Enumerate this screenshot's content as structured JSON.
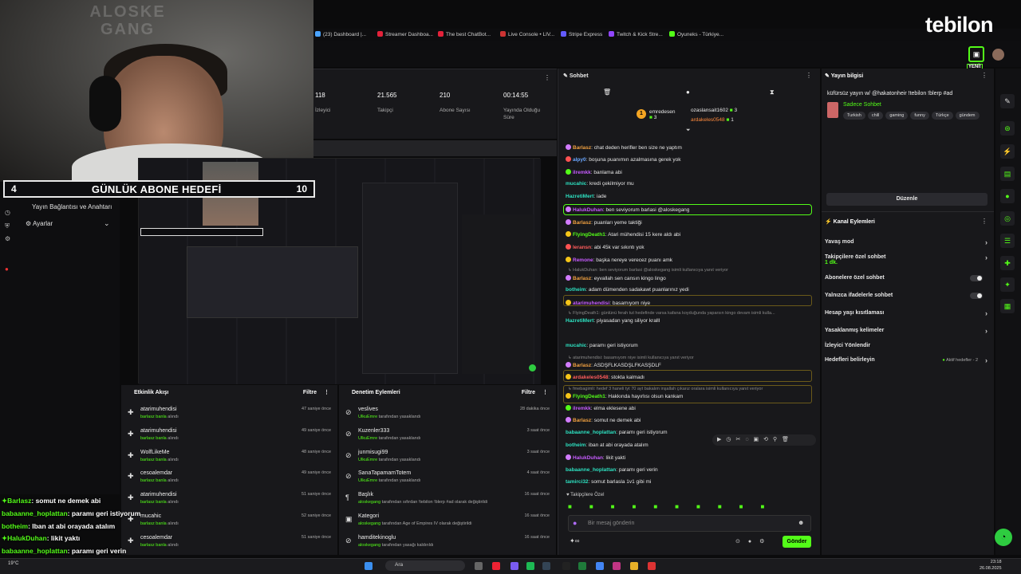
{
  "webcam": {
    "watermark": "ALOSKE GANG"
  },
  "brand": {
    "name": "tebilon"
  },
  "browser_tabs": [
    {
      "label": "(23) Dashboard |...",
      "color": "#4aa3ff"
    },
    {
      "label": "Streamer Dashboa...",
      "color": "#e3223a"
    },
    {
      "label": "The best ChatBot...",
      "color": "#e3223a"
    },
    {
      "label": "Live Console • LIV...",
      "color": "#cc3333"
    },
    {
      "label": "Stripe Express",
      "color": "#635bff"
    },
    {
      "label": "Twitch & Kick Stre...",
      "color": "#9146ff"
    },
    {
      "label": "Oyuneks - Türkiye...",
      "color": "#53fc18"
    }
  ],
  "new_badge": "YENİ!",
  "stats": [
    {
      "value": "118",
      "label": "İzleyici"
    },
    {
      "value": "21.565",
      "label": "Takipçi"
    },
    {
      "value": "210",
      "label": "Abone Sayısı"
    },
    {
      "value": "00:14:55",
      "label": "Yayında Olduğu Süre"
    }
  ],
  "abone_hedefi": {
    "current": "4",
    "title": "GÜNLÜK ABONE HEDEFİ",
    "target": "10"
  },
  "left_menu": {
    "connection": "Yayın Bağlantısı ve Anahtarı",
    "settings": "Ayarlar"
  },
  "activity": {
    "title": "Etkinlik Akışı",
    "filter": "Filtre",
    "items": [
      {
        "name": "atarimuhendisi",
        "sub_user": "barlasz",
        "sub_text": "banla",
        "sub_tail": "alındı",
        "time": "47 saniye önce"
      },
      {
        "name": "atarimuhendisi",
        "sub_user": "barlasz",
        "sub_text": "banla",
        "sub_tail": "alındı",
        "time": "49 saniye önce"
      },
      {
        "name": "WolfLikeMe",
        "sub_user": "barlasz",
        "sub_text": "banla",
        "sub_tail": "alındı",
        "time": "48 saniye önce"
      },
      {
        "name": "cesoalemdar",
        "sub_user": "barlasz",
        "sub_text": "banla",
        "sub_tail": "alındı",
        "time": "49 saniye önce"
      },
      {
        "name": "atarimuhendisi",
        "sub_user": "barlasz",
        "sub_text": "banla",
        "sub_tail": "alındı",
        "time": "51 saniye önce"
      },
      {
        "name": "mucahic",
        "sub_user": "barlasz",
        "sub_text": "banla",
        "sub_tail": "alındı",
        "time": "52 saniye önce"
      },
      {
        "name": "cesoalemdar",
        "sub_user": "barlasz",
        "sub_text": "banla",
        "sub_tail": "alındı",
        "time": "51 saniye önce"
      }
    ]
  },
  "moderation": {
    "title": "Denetim Eylemleri",
    "filter": "Filtre",
    "items": [
      {
        "icon": "⊘",
        "name": "veslives",
        "sub_user": "UlkuEmre",
        "sub_text": "tarafından yasaklandı",
        "time": "28 dakika önce"
      },
      {
        "icon": "⊘",
        "name": "Kuzenler333",
        "sub_user": "UlkuEmre",
        "sub_text": "tarafından yasaklandı",
        "time": "3 saat önce"
      },
      {
        "icon": "⊘",
        "name": "junmisugi99",
        "sub_user": "UlkuEmre",
        "sub_text": "tarafından yasaklandı",
        "time": "3 saat önce"
      },
      {
        "icon": "⊘",
        "name": "SanaTapamamTotem",
        "sub_user": "UlkuEmre",
        "sub_text": "tarafından yasaklandı",
        "time": "4 saat önce"
      },
      {
        "icon": "¶",
        "name": "Başlık",
        "sub_user": "aloskegang",
        "sub_text": "tarafından sıfırdan !tebilon !blerp #ad olarak değiştirildi",
        "time": "16 saat önce"
      },
      {
        "icon": "▣",
        "name": "Kategori",
        "sub_user": "aloskegang",
        "sub_text": "tarafından Age of Empires IV olarak değiştirildi",
        "time": "16 saat önce"
      },
      {
        "icon": "⊘",
        "name": "hamditekinoglu",
        "sub_user": "aloskegang",
        "sub_text": "tarafından yasağı kaldırıldı",
        "time": "16 saat önce"
      }
    ]
  },
  "overlay_chat": [
    {
      "user": "Barlasz",
      "text": ": somut ne demek abi",
      "icon": "✦"
    },
    {
      "user": "babaanne_hoplattan",
      "text": ": paramı geri istiyorum",
      "icon": ""
    },
    {
      "user": "botheim",
      "text": ": Iban at abi orayada atalım",
      "icon": ""
    },
    {
      "user": "HalukDuhan",
      "text": ": likit yaktı",
      "icon": "✦"
    },
    {
      "user": "babaanne_hoplattan",
      "text": ": paramı geri verin",
      "icon": ""
    },
    {
      "user": "tamirci32",
      "text": ": somut barlasla 1v1 gibi mi",
      "icon": ""
    }
  ],
  "chat": {
    "title": "Sohbet",
    "top_gifters": {
      "first": "emredesen",
      "first_count": "3",
      "second": "ozaslansait1602",
      "second_count": "3",
      "third": "ardakeles0548",
      "third_count": "1"
    },
    "messages": [
      {
        "user": "Barlasz",
        "color": "#f0a040",
        "text": ": chat deden herifler ben size ne yaptım",
        "badge": "#d27cff"
      },
      {
        "user": "alpy0",
        "color": "#6aa7ff",
        "text": ": boşuna puanımın azalmasına gerek yok",
        "badge": "#ff5252"
      },
      {
        "user": "ilremkk",
        "color": "#c75cff",
        "text": ": banlama abi",
        "badge": "#53fc18"
      },
      {
        "user": "mucahic",
        "color": "#2de0c0",
        "text": ": kredi çekilmiyor mu",
        "badge": ""
      },
      {
        "user": "HazretiMert",
        "color": "#2de0c0",
        "text": ": iade",
        "badge": ""
      },
      {
        "user": "HalukDuhan",
        "color": "#c75cff",
        "text": ": ben seviyorum barlasi @aloskegang",
        "badge": "#d27cff"
      },
      {
        "user": "Barlasz",
        "color": "#f0a040",
        "text": ": puanları yeme taktiği",
        "badge": "#d27cff"
      },
      {
        "user": "FlyingDeath1",
        "color": "#53fc18",
        "text": ": Atari mühendisi 15 kere aldı abi",
        "badge": "#f5c518"
      },
      {
        "user": "leransn",
        "color": "#ff5c5c",
        "text": ": abi 45k var sıkıntı yok",
        "badge": "#ff5252"
      },
      {
        "user": "Remone",
        "color": "#c75cff",
        "text": ": başka nereye verecez puanı amk",
        "badge": "#f5c518"
      },
      {
        "user": "Barlasz",
        "color": "#f0a040",
        "text": ": eyvallah sen cansın kingo lingo",
        "badge": "#d27cff"
      },
      {
        "user": "botheim",
        "color": "#2de0c0",
        "text": ": adam dümenden sadakawt puanlarınız yedi",
        "badge": ""
      },
      {
        "user": "atarimuhendisi",
        "color": "#c75cff",
        "text": ": basamıyom niye",
        "badge": "#f5c518"
      },
      {
        "user": "HazretiMert",
        "color": "#2de0c0",
        "text": ": piyasadan yang siliyor kralll",
        "badge": ""
      },
      {
        "user": "mucahic",
        "color": "#2de0c0",
        "text": ": paramı geri istiyorum",
        "badge": ""
      },
      {
        "user": "Barlasz",
        "color": "#f0a040",
        "text": ": ASDŞFLKASDŞLFKASŞDLF",
        "badge": "#d27cff"
      },
      {
        "user": "ardakeles0548",
        "color": "#ff5c5c",
        "text": ": stokta kalmadı",
        "badge": "#f5c518"
      },
      {
        "user": "FlyingDeath1",
        "color": "#53fc18",
        "text": ": Hakkında hayırlısı olsun kankam",
        "badge": "#f5c518"
      },
      {
        "user": "ilremkk",
        "color": "#c75cff",
        "text": ": elma eklesene abi",
        "badge": "#53fc18"
      },
      {
        "user": "Barlasz",
        "color": "#f0a040",
        "text": ": somut ne demek abi",
        "badge": "#d27cff"
      },
      {
        "user": "babaanne_hoplattan",
        "color": "#2de0c0",
        "text": ": paramı geri istiyorum",
        "badge": ""
      },
      {
        "user": "botheim",
        "color": "#2de0c0",
        "text": ": iban at abi orayada atalım",
        "badge": ""
      },
      {
        "user": "HalukDuhan",
        "color": "#c75cff",
        "text": ": likit yakti",
        "badge": "#d27cff"
      },
      {
        "user": "babaanne_hoplattan",
        "color": "#2de0c0",
        "text": ": paramı geri verin",
        "badge": ""
      },
      {
        "user": "tamirci32",
        "color": "#2de0c0",
        "text": ": somut barlasla 1v1 gibi mi",
        "badge": ""
      }
    ],
    "replies": [
      "HalukDuhan: ben seviyorum barlasi @aloskegang isimli kullanıcıya yanıt veriyor",
      "FlyingDeath1: günlünü ferah tut hedefinde varsa kafana koyduğunda yaparsın kingo devam isimli kulla...",
      "atarimuhendisi: basamıyom niye isimli kullanıcıya yanıt veriyor",
      "fmebagimli: hedef 3 haneli tyt 70 ayt bakalım inşallah çıkarız oralara isimli kullanıcıya yanıt veriyor"
    ],
    "follower_only": "Takipçilere Özel",
    "input_placeholder": "Bir mesaj gönderin",
    "send": "Gönder"
  },
  "stream_info": {
    "title": "Yayın bilgisi",
    "text": "küfürsüz yayın w/ @hakatonheir !tebilon !blerp #ad",
    "category": "Sadece Sohbet",
    "tags": [
      "Turkish",
      "chill",
      "gaming",
      "funny",
      "Türkçe",
      "gündem"
    ],
    "edit": "Düzenle"
  },
  "channel_actions": {
    "title": "Kanal Eylemleri",
    "slow_mode": "Yavaş mod",
    "followers_only": "Takipçilere özel sohbet",
    "followers_only_sub": "1 dk.",
    "subs_only": "Abonelere özel sohbet",
    "emote_only": "Yalnızca ifadelerle sohbet",
    "account_age": "Hesap yaşı kısıtlaması",
    "banned_words": "Yasaklanmış kelimeler",
    "viewer_redirect": "İzleyici Yönlendir",
    "goals": "Hedefleri belirleyin",
    "goals_status": "Aktif hedefler - 2"
  },
  "taskbar": {
    "search": "Ara",
    "time": "23:18",
    "date": "26.08.2025",
    "weather": "19°C"
  }
}
